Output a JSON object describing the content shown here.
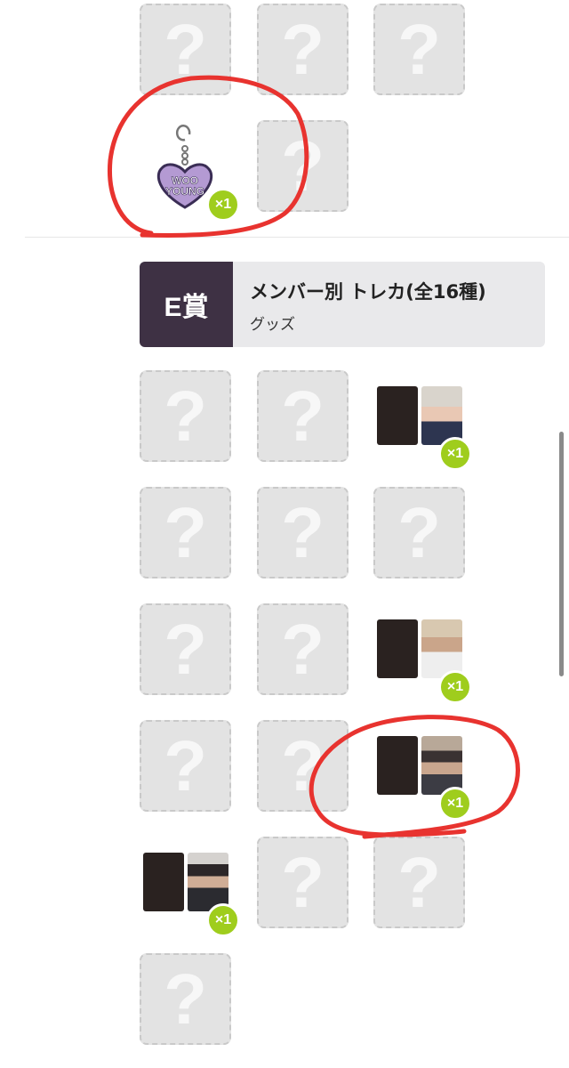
{
  "tiles": {
    "unknown_mark": "?"
  },
  "items": {
    "keychain": {
      "text_line1": "WOO",
      "text_line2": "YOUNG",
      "badge": "×1"
    },
    "card1": {
      "badge": "×1"
    },
    "card2": {
      "badge": "×1"
    },
    "card3": {
      "badge": "×1"
    },
    "card4": {
      "badge": "×1"
    }
  },
  "prize": {
    "rank": "E賞",
    "title": "メンバー別 トレカ(全16種)",
    "category": "グッズ"
  },
  "colors": {
    "badge": "#9fcd1d",
    "rank_bg": "#3e3144",
    "header_bg": "#e9e9eb",
    "annotation": "#e8332f"
  }
}
